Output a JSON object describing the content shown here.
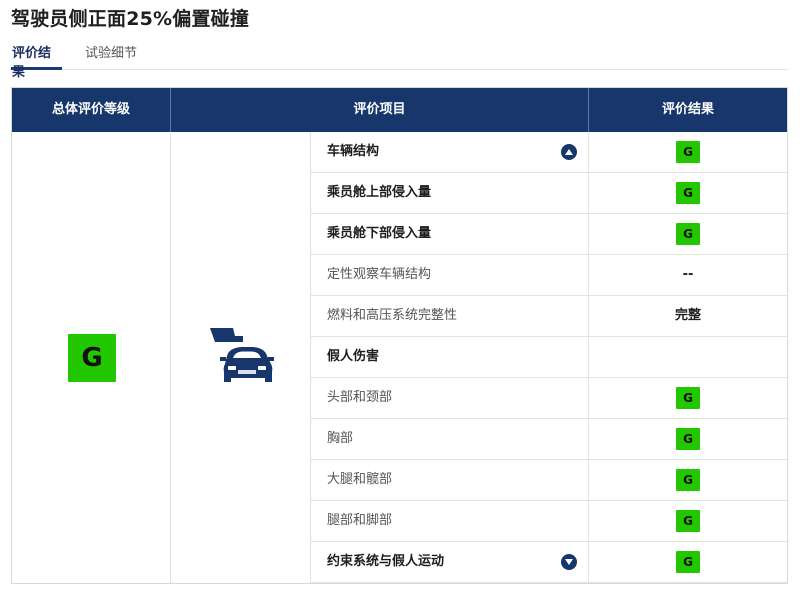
{
  "page": {
    "title": "驾驶员侧正面25%偏置碰撞"
  },
  "tabs": [
    {
      "label": "评价结果",
      "active": true
    },
    {
      "label": "试验细节",
      "active": false
    }
  ],
  "table": {
    "headers": [
      "总体评价等级",
      "评价项目",
      "评价结果"
    ],
    "overall_rating": "G",
    "image_icon": "car-offset-crash-icon",
    "rows": [
      {
        "item": "车辆结构",
        "bold": true,
        "result": "G",
        "result_type": "badge",
        "toggle": "collapse-up"
      },
      {
        "item": "乘员舱上部侵入量",
        "bold": true,
        "result": "G",
        "result_type": "badge"
      },
      {
        "item": "乘员舱下部侵入量",
        "bold": true,
        "result": "G",
        "result_type": "badge"
      },
      {
        "item": "定性观察车辆结构",
        "bold": false,
        "result": "--",
        "result_type": "text"
      },
      {
        "item": "燃料和高压系统完整性",
        "bold": false,
        "result": "完整",
        "result_type": "text"
      },
      {
        "item": "假人伤害",
        "bold": true,
        "result": "",
        "result_type": "none"
      },
      {
        "item": "头部和颈部",
        "bold": false,
        "result": "G",
        "result_type": "badge"
      },
      {
        "item": "胸部",
        "bold": false,
        "result": "G",
        "result_type": "badge"
      },
      {
        "item": "大腿和髋部",
        "bold": false,
        "result": "G",
        "result_type": "badge"
      },
      {
        "item": "腿部和脚部",
        "bold": false,
        "result": "G",
        "result_type": "badge"
      },
      {
        "item": "约束系统与假人运动",
        "bold": true,
        "result": "G",
        "result_type": "badge",
        "toggle": "expand-down"
      }
    ]
  },
  "colors": {
    "header_bg": "#16366c",
    "good_badge": "#22c700",
    "tab_accent": "#1b3a74"
  }
}
